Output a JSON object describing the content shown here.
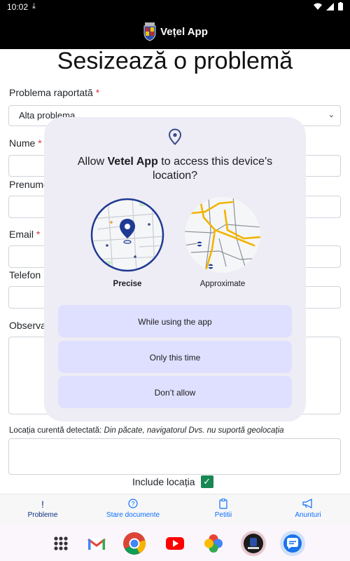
{
  "status_bar": {
    "time": "10:02"
  },
  "header": {
    "app_name": "Vețel App"
  },
  "page": {
    "title": "Sesizează o problemă"
  },
  "form": {
    "problem_label": "Problema raportată",
    "problem_value": "Alta problema",
    "required_mark": "*",
    "name_label": "Nume",
    "firstname_label": "Prenume",
    "email_label": "Email",
    "phone_label": "Telefon",
    "obs_label": "Observații",
    "location_prefix": "Locația curentă detectată:",
    "location_msg": "Din păcate, navigatorul Dvs. nu suportă geolocația",
    "include_location": "Include locația"
  },
  "app_nav": [
    {
      "label": "Probleme",
      "icon": "exclamation-icon"
    },
    {
      "label": "Stare documente",
      "icon": "question-circle-icon"
    },
    {
      "label": "Petitii",
      "icon": "clipboard-icon"
    },
    {
      "label": "Anunturi",
      "icon": "megaphone-icon"
    }
  ],
  "dialog": {
    "title_pre": "Allow ",
    "title_app": "Vetel App",
    "title_post": " to access this device’s location?",
    "precise": "Precise",
    "approximate": "Approximate",
    "btn_while": "While using the app",
    "btn_once": "Only this time",
    "btn_deny": "Don’t allow"
  },
  "colors": {
    "accent": "#0d6efd",
    "required": "#dc3545",
    "check": "#198754",
    "dialog_bg": "#eeecf4",
    "dialog_btn": "#dfe0ff"
  }
}
